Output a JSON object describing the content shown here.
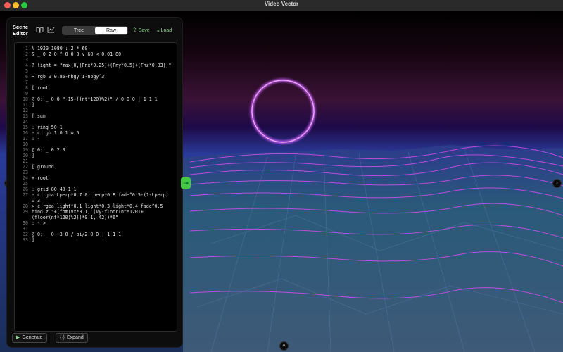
{
  "window": {
    "title": "Video Vector"
  },
  "panel": {
    "title_line1": "Scene",
    "title_line2": "Editor",
    "tabs": {
      "tree": "Tree",
      "raw": "Raw"
    },
    "save": "Save",
    "load": "Load",
    "generate": "Generate",
    "expand": "Expand"
  },
  "code_lines": [
    {
      "n": "1",
      "t": "% 1920 1080 : 2 * 60"
    },
    {
      "n": "2",
      "t": "& _ 0 2 0 ^ 0 0 0 v 60 < 0.01 80"
    },
    {
      "n": "3",
      "t": ""
    },
    {
      "n": "4",
      "t": "? light = \"max(0,(Fnx*0.25)+(Fny*0.5)+(Fnz*0.83))\""
    },
    {
      "n": "5",
      "t": ""
    },
    {
      "n": "6",
      "t": "~ rgb 0 0.85-nbgy 1-nbgy^3"
    },
    {
      "n": "7",
      "t": ""
    },
    {
      "n": "8",
      "t": "[ root"
    },
    {
      "n": "9",
      "t": ""
    },
    {
      "n": "10",
      "t": "@ 0: _ 0 0 \"-15+((nt*120)%2)\" / 0 0 0 | 1 1 1"
    },
    {
      "n": "11",
      "t": "]"
    },
    {
      "n": "12",
      "t": ""
    },
    {
      "n": "13",
      "t": "[ sun"
    },
    {
      "n": "14",
      "t": ""
    },
    {
      "n": "15",
      "t": ": ring 50 1"
    },
    {
      "n": "16",
      "t": "- c rgb 1 0 1 w 5"
    },
    {
      "n": "17",
      "t": ": -"
    },
    {
      "n": "18",
      "t": ""
    },
    {
      "n": "19",
      "t": "@ 0: _ 0 2 0"
    },
    {
      "n": "20",
      "t": "]"
    },
    {
      "n": "21",
      "t": ""
    },
    {
      "n": "22",
      "t": "[ ground"
    },
    {
      "n": "23",
      "t": ""
    },
    {
      "n": "24",
      "t": "+ root"
    },
    {
      "n": "25",
      "t": ""
    },
    {
      "n": "26",
      "t": ": grid 80 40 1 1"
    },
    {
      "n": "27",
      "t": "- c rgba Lperp*0.7 0 Lperp*0.8 fade^0.5-(1-Lperp) w 3"
    },
    {
      "n": "28",
      "t": "> c rgba light*0.1 light*0.3 light*0.4 fade^0.5"
    },
    {
      "n": "29",
      "t": "bind z \"+(fbm(Vx*0.1, (Vy-floor(nt*120)+(floor(nt*120)%2))*0.1, 42))*6\""
    },
    {
      "n": "30",
      "t": ": - >"
    },
    {
      "n": "31",
      "t": ""
    },
    {
      "n": "32",
      "t": "@ 0: _ 0 -3 0 / pi/2 0 0 | 1 1 1"
    },
    {
      "n": "33",
      "t": "]"
    }
  ],
  "icons": {
    "book": "book-icon",
    "chart": "chart-icon",
    "save": "share-icon",
    "load": "download-icon",
    "generate": "play-icon",
    "expand": "braces-icon"
  },
  "colors": {
    "accent": "#45c945",
    "ring": "#c040ff",
    "sky_top": "#000000",
    "horizon": "#5a1a9a"
  }
}
